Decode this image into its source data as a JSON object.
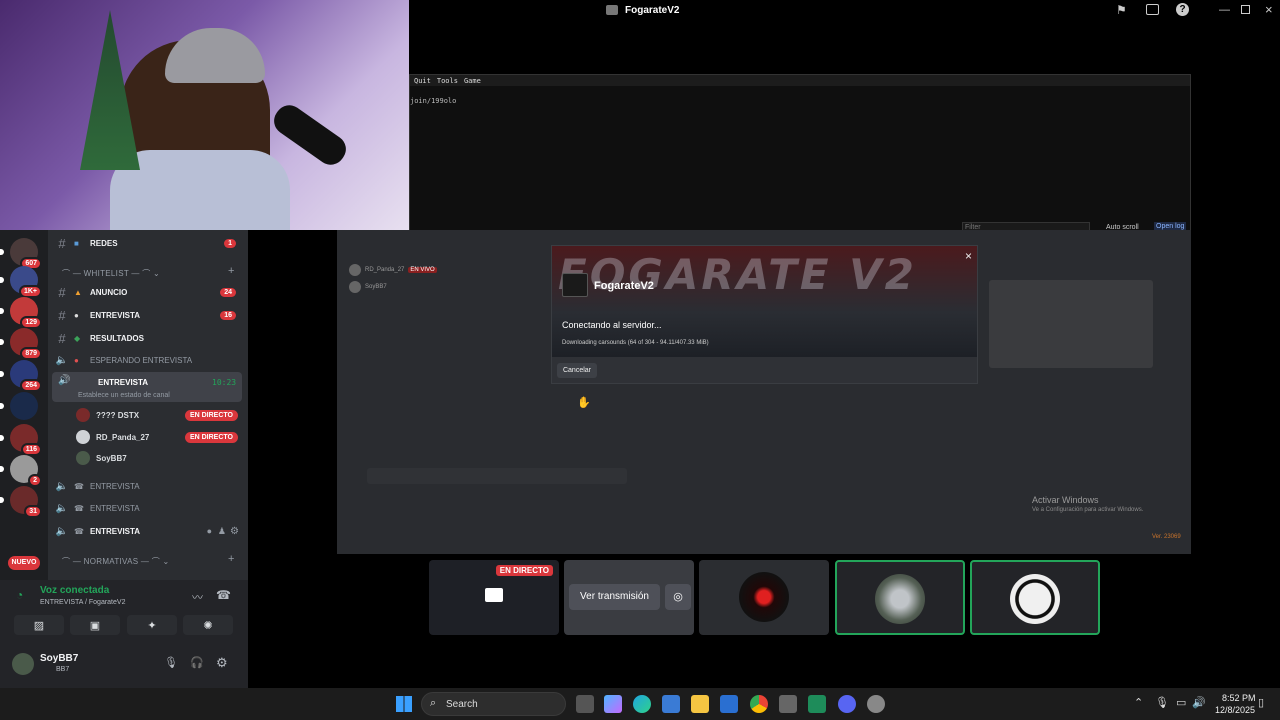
{
  "window_title": "FogarateV2",
  "console": {
    "menu": [
      "Quit",
      "Tools",
      "Game"
    ],
    "line": "join/199olo",
    "filter_placeholder": "Filter",
    "auto_scroll": "Auto scroll",
    "open_log": "Open log"
  },
  "dialog": {
    "banner_text": "FOGARATE V2",
    "name": "FogarateV2",
    "status": "Conectando al servidor...",
    "progress_text": "Downloading carsounds (64 of 304 - 94.11/407.33 MiB)",
    "cancel": "Cancelar",
    "close": "×"
  },
  "game_bg": {
    "activate_title": "Activar Windows",
    "activate_sub": "Ve a Configuración para activar Windows.",
    "version": "Ver. 23069",
    "mini_users": [
      "RD_Panda_27",
      "SoyBB7"
    ],
    "mini_live": "EN VIVO"
  },
  "servers": [
    {
      "badge": "607"
    },
    {
      "badge": "1K+"
    },
    {
      "badge": "129"
    },
    {
      "badge": "879"
    },
    {
      "badge": "264"
    },
    {
      "badge": ""
    },
    {
      "badge": "116"
    },
    {
      "badge": "2"
    },
    {
      "badge": "31"
    }
  ],
  "nuevo_label": "NUEVO",
  "channels": {
    "redes": {
      "name": "REDES",
      "count": "1"
    },
    "cat_whitelist": "WHITELIST",
    "anuncio": {
      "name": "ANUNCIO",
      "count": "24"
    },
    "entrevista1": {
      "name": "ENTREVISTA",
      "count": "16"
    },
    "resultados": {
      "name": "RESULTADOS"
    },
    "esperando": {
      "name": "ESPERANDO ENTREVISTA"
    },
    "entrevista_active": {
      "name": "ENTREVISTA",
      "time": "10:23",
      "status": "Establece un estado de canal"
    },
    "voice_users": [
      {
        "name": "???? DSTX",
        "live": "EN DIRECTO"
      },
      {
        "name": "RD_Panda_27",
        "live": "EN DIRECTO"
      },
      {
        "name": "SoyBB7",
        "live": ""
      }
    ],
    "entrevista2": {
      "name": "ENTREVISTA"
    },
    "entrevista3": {
      "name": "ENTREVISTA"
    },
    "entrevista4": {
      "name": "ENTREVISTA"
    },
    "cat_normativas": "NORMATIVAS"
  },
  "voice": {
    "status": "Voz conectada",
    "location": "ENTREVISTA / FogarateV2"
  },
  "user": {
    "name": "SoyBB7",
    "tag": "BB7"
  },
  "stream_tiles": {
    "live": "EN DIRECTO",
    "watch": "Ver transmisión"
  },
  "taskbar": {
    "search": "Search",
    "time": "8:52 PM",
    "date": "12/8/2025"
  },
  "colors": {
    "accent_red": "#da373c",
    "voice_green": "#23a55a",
    "discord_blurple": "#5865f2"
  }
}
